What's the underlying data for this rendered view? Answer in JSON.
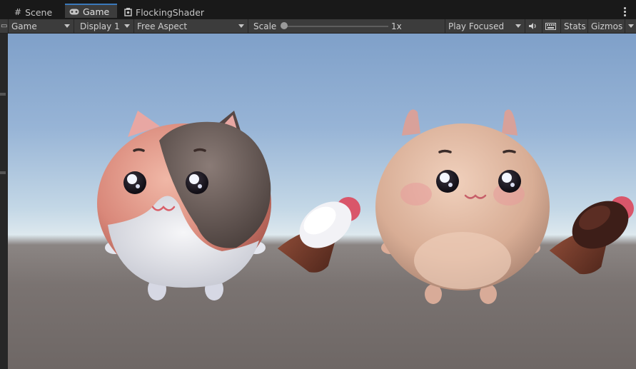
{
  "tabs": [
    {
      "label": "Scene",
      "icon": "grid-icon"
    },
    {
      "label": "Game",
      "icon": "gamepad-icon",
      "active": true
    },
    {
      "label": "FlockingShader",
      "icon": "shader-icon"
    }
  ],
  "toolbar": {
    "view_mode": "Game",
    "display": "Display 1",
    "aspect": "Free Aspect",
    "scale_label": "Scale",
    "scale_value": "1x",
    "play_mode": "Play Focused",
    "stats": "Stats",
    "gizmos": "Gizmos"
  },
  "colors": {
    "toolbar_bg": "#3c3c3c",
    "tabbar_bg": "#191919",
    "active_tab_accent": "#3a79bb",
    "sky_top": "#7fa0c9",
    "ground": "#7a7371"
  }
}
